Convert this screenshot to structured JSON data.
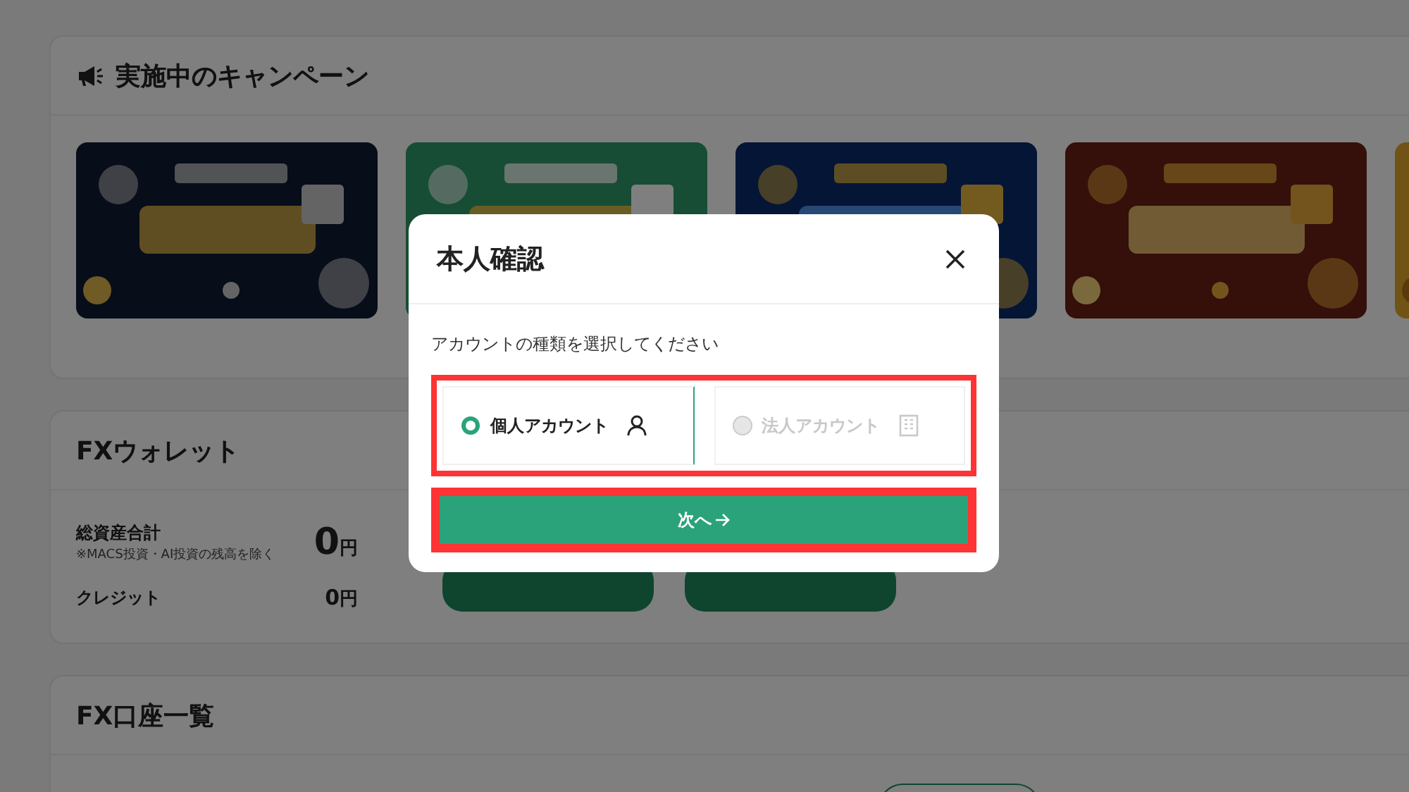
{
  "campaigns": {
    "title": "実施中のキャンペーン"
  },
  "wallet": {
    "title": "FXウォレット",
    "rows": [
      {
        "label": "総資産合計",
        "note": "※MACS投資・AI投資の残高を除く",
        "amount": "0",
        "unit": "円",
        "large": true
      },
      {
        "label": "クレジット",
        "amount": "0",
        "unit": "円",
        "large": false
      }
    ]
  },
  "accounts": {
    "title": "FX口座一覧"
  },
  "dialog": {
    "title": "本人確認",
    "prompt": "アカウントの種類を選択してください",
    "options_highlighted": true,
    "options": [
      {
        "label": "個人アカウント",
        "kind": "person",
        "selected": true,
        "disabled": false
      },
      {
        "label": "法人アカウント",
        "kind": "building",
        "selected": false,
        "disabled": true
      }
    ],
    "next_button": {
      "label": "次へ",
      "highlighted": true
    }
  }
}
